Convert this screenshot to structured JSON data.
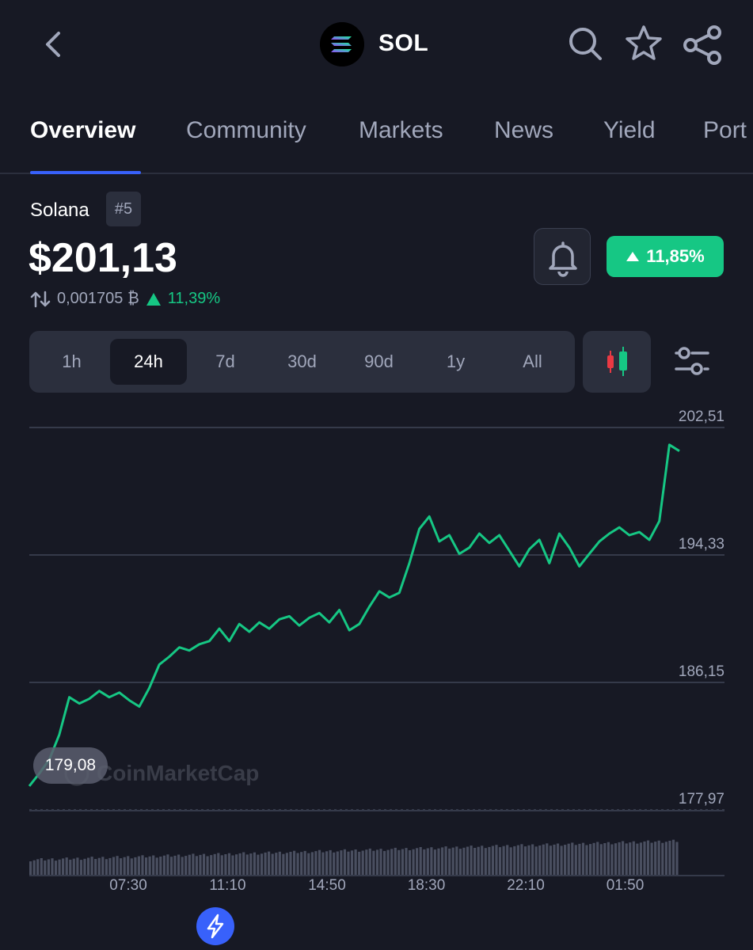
{
  "header": {
    "symbol": "SOL",
    "icons": [
      "back-arrow-icon",
      "solana-logo-icon",
      "search-icon",
      "star-icon",
      "share-icon"
    ]
  },
  "tabs": [
    {
      "label": "Overview",
      "active": true
    },
    {
      "label": "Community",
      "active": false
    },
    {
      "label": "Markets",
      "active": false
    },
    {
      "label": "News",
      "active": false
    },
    {
      "label": "Yield",
      "active": false
    },
    {
      "label": "Port",
      "active": false
    }
  ],
  "coin": {
    "name": "Solana",
    "rank": "#5",
    "price": "$201,13",
    "btc_price": "0,001705 ₿",
    "btc_change": "11,39%",
    "change_24h": "11,85%"
  },
  "ranges": [
    "1h",
    "24h",
    "7d",
    "30d",
    "90d",
    "1y",
    "All"
  ],
  "selected_range": "24h",
  "colors": {
    "background": "#171924",
    "accent": "#3861fb",
    "positive": "#16c784",
    "negative": "#ea3943",
    "muted": "#a1a7bb"
  },
  "chart_labels": {
    "start_value": "179,08",
    "watermark": "CoinMarketCap"
  },
  "chart_data": {
    "type": "line",
    "title": "",
    "xlabel": "",
    "ylabel": "",
    "x_ticks": [
      "07:30",
      "11:10",
      "14:50",
      "18:30",
      "22:10",
      "01:50"
    ],
    "y_ticks": [
      "202,51",
      "194,33",
      "186,15",
      "177,97"
    ],
    "ylim": [
      177.97,
      202.51
    ],
    "start_value": 179.08,
    "values": [
      179.5,
      180.3,
      181.2,
      182.8,
      185.2,
      184.8,
      185.1,
      185.6,
      185.2,
      185.5,
      185.0,
      184.6,
      185.8,
      187.3,
      187.8,
      188.4,
      188.2,
      188.6,
      188.8,
      189.6,
      188.8,
      189.9,
      189.4,
      190.0,
      189.6,
      190.2,
      190.4,
      189.8,
      190.3,
      190.6,
      190.0,
      190.8,
      189.5,
      189.9,
      191.0,
      192.0,
      191.6,
      191.9,
      193.8,
      196.0,
      196.8,
      195.2,
      195.6,
      194.4,
      194.8,
      195.7,
      195.1,
      195.6,
      194.6,
      193.6,
      194.7,
      195.3,
      193.8,
      195.7,
      194.8,
      193.6,
      194.4,
      195.2,
      195.7,
      196.1,
      195.6,
      195.8,
      195.3,
      196.5,
      201.4,
      201.0
    ],
    "volume": "bars",
    "grid": true,
    "series": [
      {
        "name": "",
        "color": "#16c784"
      }
    ]
  }
}
